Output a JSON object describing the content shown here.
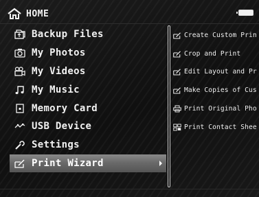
{
  "header": {
    "title": "HOME"
  },
  "menu": {
    "items": [
      {
        "label": "Backup Files",
        "icon": "backup-files-icon"
      },
      {
        "label": "My Photos",
        "icon": "camera-icon"
      },
      {
        "label": "My Videos",
        "icon": "video-camera-icon"
      },
      {
        "label": "My Music",
        "icon": "music-note-icon"
      },
      {
        "label": "Memory Card",
        "icon": "memory-card-icon"
      },
      {
        "label": "USB Device",
        "icon": "usb-icon"
      },
      {
        "label": "Settings",
        "icon": "wrench-icon"
      },
      {
        "label": "Print Wizard",
        "icon": "print-wizard-icon",
        "selected": true
      }
    ]
  },
  "submenu": {
    "items": [
      {
        "label": "Create Custom Prin",
        "icon": "print-wizard-icon"
      },
      {
        "label": "Crop and Print",
        "icon": "print-wizard-icon"
      },
      {
        "label": "Edit Layout and Pr",
        "icon": "print-wizard-icon"
      },
      {
        "label": "Make Copies of Cus",
        "icon": "print-wizard-icon"
      },
      {
        "label": "Print Original Pho",
        "icon": "printer-icon"
      },
      {
        "label": "Print Contact Shee",
        "icon": "contact-sheet-icon"
      }
    ]
  },
  "colors": {
    "background": "#111111",
    "text": "#f2f2f2",
    "highlight": "#707070"
  }
}
